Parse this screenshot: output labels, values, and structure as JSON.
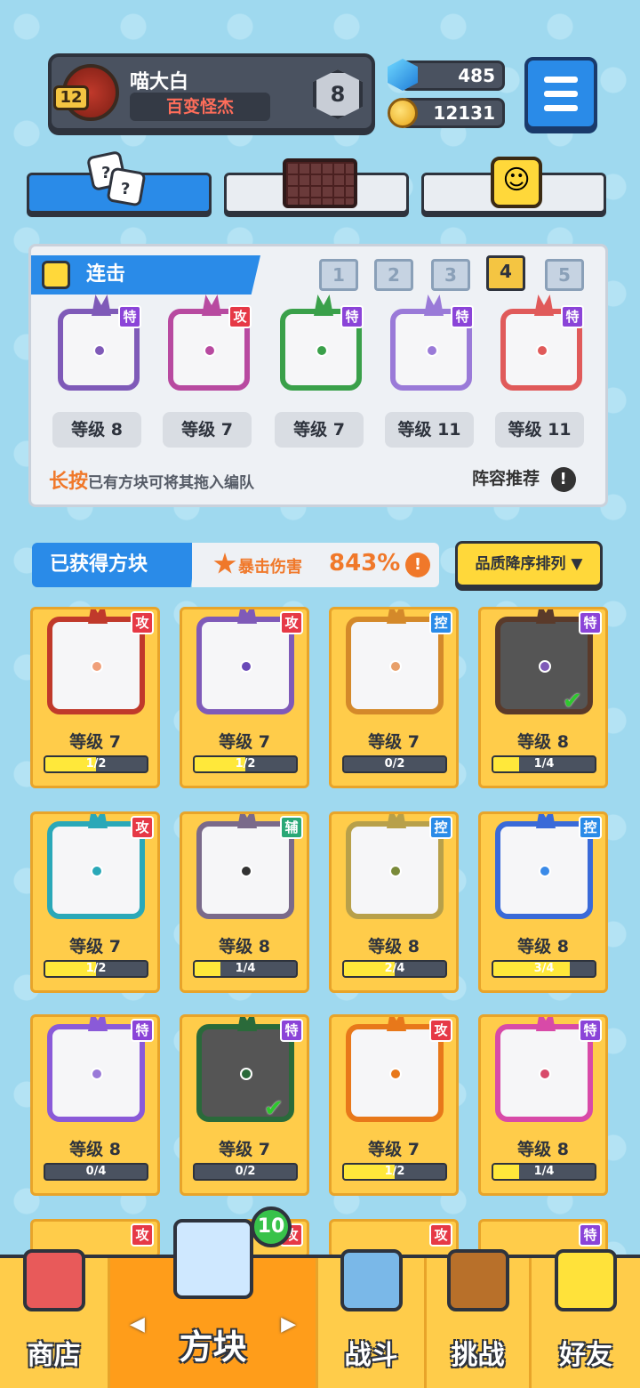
{
  "profile": {
    "name": "喵大白",
    "title": "百变怪杰",
    "level": "12",
    "rank": "8"
  },
  "resources": {
    "gems": "485",
    "coins": "12131"
  },
  "deck": {
    "title": "连击",
    "slots": [
      "1",
      "2",
      "3",
      "4",
      "5"
    ],
    "active_slot": "4",
    "cards": [
      {
        "badge": "特",
        "level": "等级 8",
        "color": "#7f5ab8"
      },
      {
        "badge": "攻",
        "level": "等级 7",
        "color": "#b84aa0"
      },
      {
        "badge": "特",
        "level": "等级 7",
        "color": "#3aa04a"
      },
      {
        "badge": "特",
        "level": "等级 11",
        "color": "#9a7ad8"
      },
      {
        "badge": "特",
        "level": "等级 11",
        "color": "#e05a5a"
      }
    ],
    "hint_highlight": "长按",
    "hint_text": "已有方块可将其拖入编队",
    "recommend": "阵容推荐"
  },
  "obtained": {
    "title": "已获得方块",
    "crit_label": "暴击伤害",
    "crit_value": "843%",
    "sort_label": "品质降序排列"
  },
  "grid": [
    {
      "badge": "攻",
      "type": "gong",
      "level": "等级 7",
      "progress": "1/2",
      "fill": 0.5,
      "color": "#c0392b",
      "dot": "#f0a07a"
    },
    {
      "badge": "攻",
      "type": "gong",
      "level": "等级 7",
      "progress": "1/2",
      "fill": 0.5,
      "color": "#7f5ab8",
      "dot": "#6a4ab8"
    },
    {
      "badge": "控",
      "type": "kong",
      "level": "等级 7",
      "progress": "0/2",
      "fill": 0,
      "color": "#d4892a",
      "dot": "#e8a06a"
    },
    {
      "badge": "特",
      "type": "te",
      "level": "等级 8",
      "progress": "1/4",
      "fill": 0.25,
      "color": "#5a3a2a",
      "dot": "#7f5ab8",
      "dark": true,
      "check": true
    },
    {
      "badge": "攻",
      "type": "gong",
      "level": "等级 7",
      "progress": "1/2",
      "fill": 0.5,
      "color": "#2aa8b8",
      "dot": "#2aa8b8"
    },
    {
      "badge": "辅",
      "type": "fu",
      "level": "等级 8",
      "progress": "1/4",
      "fill": 0.25,
      "color": "#7a6a8a",
      "dot": "#333"
    },
    {
      "badge": "控",
      "type": "kong",
      "level": "等级 8",
      "progress": "2/4",
      "fill": 0.5,
      "color": "#b8a04a",
      "dot": "#7a8a3a"
    },
    {
      "badge": "控",
      "type": "kong",
      "level": "等级 8",
      "progress": "3/4",
      "fill": 0.75,
      "color": "#3a6ad8",
      "dot": "#3a8ae8"
    },
    {
      "badge": "特",
      "type": "te",
      "level": "等级 8",
      "progress": "0/4",
      "fill": 0,
      "color": "#8a5ad8",
      "dot": "#9a7ad8"
    },
    {
      "badge": "特",
      "type": "te",
      "level": "等级 7",
      "progress": "0/2",
      "fill": 0,
      "color": "#2a6a3a",
      "dot": "#2a6a3a",
      "dark": true,
      "check": true
    },
    {
      "badge": "攻",
      "type": "gong",
      "level": "等级 7",
      "progress": "1/2",
      "fill": 0.5,
      "color": "#e8781a",
      "dot": "#e8781a"
    },
    {
      "badge": "特",
      "type": "te",
      "level": "等级 8",
      "progress": "1/4",
      "fill": 0.25,
      "color": "#d84aa8",
      "dot": "#d84a6a"
    }
  ],
  "partial_row_badges": [
    "攻",
    "攻",
    "攻",
    "特"
  ],
  "nav": {
    "shop": "商店",
    "blocks": "方块",
    "battle": "战斗",
    "challenge": "挑战",
    "friends": "好友",
    "blocks_notification": "10"
  }
}
